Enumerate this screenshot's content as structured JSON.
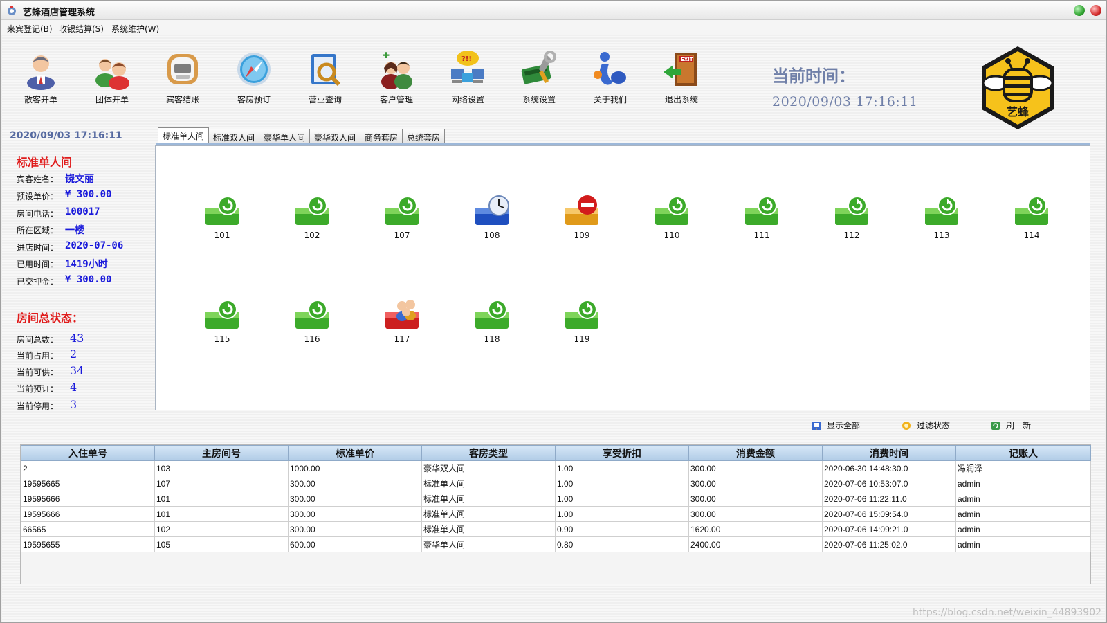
{
  "window": {
    "title": "艺蜂酒店管理系统"
  },
  "menu": [
    {
      "label": "来宾登记(B)"
    },
    {
      "label": "收银结算(S)"
    },
    {
      "label": "系统维护(W)"
    }
  ],
  "toolbar": [
    {
      "label": "散客开单",
      "icon": "guest-icon"
    },
    {
      "label": "团体开单",
      "icon": "group-icon"
    },
    {
      "label": "宾客结账",
      "icon": "checkout-icon"
    },
    {
      "label": "客房预订",
      "icon": "compass-icon"
    },
    {
      "label": "营业查询",
      "icon": "search-icon"
    },
    {
      "label": "客户管理",
      "icon": "customer-icon"
    },
    {
      "label": "网络设置",
      "icon": "network-icon"
    },
    {
      "label": "系统设置",
      "icon": "settings-icon"
    },
    {
      "label": "关于我们",
      "icon": "about-icon"
    },
    {
      "label": "退出系统",
      "icon": "exit-icon"
    }
  ],
  "clock": {
    "title": "当前时间：",
    "time": "2020/09/03  17:16:11"
  },
  "logo": {
    "text": "艺蜂"
  },
  "left_panel": {
    "date": "2020/09/03 17:16:11",
    "room_type": "标准单人间",
    "fields": [
      {
        "label": "宾客姓名：",
        "value": "饶文丽"
      },
      {
        "label": "预设单价：",
        "value": "¥ 300.00"
      },
      {
        "label": "房间电话：",
        "value": "100017"
      },
      {
        "label": "所在区域：",
        "value": "一楼"
      },
      {
        "label": "进店时间：",
        "value": "2020-07-06"
      },
      {
        "label": "已用时间：",
        "value": "1419小时"
      },
      {
        "label": "已交押金：",
        "value": "¥ 300.00"
      }
    ],
    "status_title": "房间总状态：",
    "stats": [
      {
        "label": "房间总数：",
        "value": "43"
      },
      {
        "label": "当前占用：",
        "value": "2"
      },
      {
        "label": "当前可供：",
        "value": "34"
      },
      {
        "label": "当前预订：",
        "value": "4"
      },
      {
        "label": "当前停用：",
        "value": "3"
      }
    ]
  },
  "tabs": [
    {
      "label": "标准单人间",
      "active": true
    },
    {
      "label": "标准双人间"
    },
    {
      "label": "豪华单人间"
    },
    {
      "label": "豪华双人间"
    },
    {
      "label": "商务套房"
    },
    {
      "label": "总统套房"
    }
  ],
  "rooms": [
    {
      "number": "101",
      "status": "available"
    },
    {
      "number": "102",
      "status": "available"
    },
    {
      "number": "107",
      "status": "available"
    },
    {
      "number": "108",
      "status": "reserved"
    },
    {
      "number": "109",
      "status": "disabled"
    },
    {
      "number": "110",
      "status": "available"
    },
    {
      "number": "111",
      "status": "available"
    },
    {
      "number": "112",
      "status": "available"
    },
    {
      "number": "113",
      "status": "available"
    },
    {
      "number": "114",
      "status": "available"
    },
    {
      "number": "115",
      "status": "available"
    },
    {
      "number": "116",
      "status": "available"
    },
    {
      "number": "117",
      "status": "occupied"
    },
    {
      "number": "118",
      "status": "available"
    },
    {
      "number": "119",
      "status": "available"
    }
  ],
  "actions": [
    {
      "label": "显示全部",
      "icon": "show-all-icon"
    },
    {
      "label": "过滤状态",
      "icon": "filter-icon"
    },
    {
      "label": "刷　新",
      "icon": "refresh-icon"
    }
  ],
  "table": {
    "columns": [
      "入住单号",
      "主房间号",
      "标准单价",
      "客房类型",
      "享受折扣",
      "消费金额",
      "消费时间",
      "记账人"
    ],
    "rows": [
      [
        "2",
        "103",
        "1000.00",
        "豪华双人间",
        "1.00",
        "300.00",
        "2020-06-30 14:48:30.0",
        "冯润泽"
      ],
      [
        "19595665",
        "107",
        "300.00",
        "标准单人间",
        "1.00",
        "300.00",
        "2020-07-06 10:53:07.0",
        "admin"
      ],
      [
        "19595666",
        "101",
        "300.00",
        "标准单人间",
        "1.00",
        "300.00",
        "2020-07-06 11:22:11.0",
        "admin"
      ],
      [
        "19595666",
        "101",
        "300.00",
        "标准单人间",
        "1.00",
        "300.00",
        "2020-07-06 15:09:54.0",
        "admin"
      ],
      [
        "66565",
        "102",
        "300.00",
        "标准单人间",
        "0.90",
        "1620.00",
        "2020-07-06 14:09:21.0",
        "admin"
      ],
      [
        "19595655",
        "105",
        "600.00",
        "豪华单人间",
        "0.80",
        "2400.00",
        "2020-07-06 11:25:02.0",
        "admin"
      ]
    ]
  },
  "watermark": "https://blog.csdn.net/weixin_44893902"
}
